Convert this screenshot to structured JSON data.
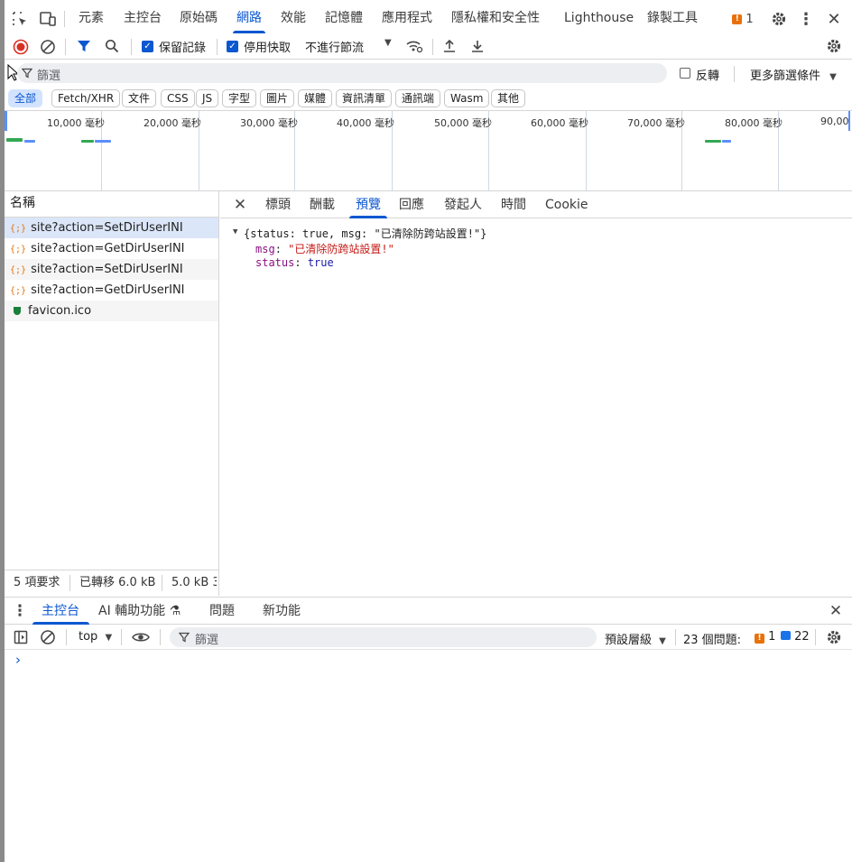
{
  "topbar": {
    "tabs": [
      {
        "label": "元素"
      },
      {
        "label": "主控台"
      },
      {
        "label": "原始碼"
      },
      {
        "label": "網路"
      },
      {
        "label": "效能"
      },
      {
        "label": "記憶體"
      },
      {
        "label": "應用程式"
      },
      {
        "label": "隱私權和安全性"
      },
      {
        "label": "Lighthouse"
      },
      {
        "label": "錄製工具"
      }
    ],
    "active_tab": "網路",
    "issue_count": "1",
    "icons": [
      "inspect-element-icon",
      "device-toolbar-icon",
      "issues-icon",
      "settings-icon",
      "more-vert-icon",
      "close-icon"
    ]
  },
  "toolbar": {
    "preserve_log_label": "保留記錄",
    "preserve_log_checked": true,
    "disable_cache_label": "停用快取",
    "disable_cache_checked": true,
    "throttling_value": "不進行節流"
  },
  "filter": {
    "placeholder": "篩選",
    "invert_label": "反轉",
    "more_filters_label": "更多篩選條件"
  },
  "type_filters": [
    "全部",
    "Fetch/XHR",
    "文件",
    "CSS",
    "JS",
    "字型",
    "圖片",
    "媒體",
    "資訊清單",
    "通訊端",
    "Wasm",
    "其他"
  ],
  "timeline": {
    "ticks": [
      "10,000 毫秒",
      "20,000 毫秒",
      "30,000 毫秒",
      "40,000 毫秒",
      "50,000 毫秒",
      "60,000 毫秒",
      "70,000 毫秒",
      "80,000 毫秒",
      "90,00"
    ]
  },
  "requests": {
    "header": "名稱",
    "items": [
      {
        "name": "site?action=SetDirUserINI",
        "type": "xhr"
      },
      {
        "name": "site?action=GetDirUserINI",
        "type": "xhr"
      },
      {
        "name": "site?action=SetDirUserINI",
        "type": "xhr"
      },
      {
        "name": "site?action=GetDirUserINI",
        "type": "xhr"
      },
      {
        "name": "favicon.ico",
        "type": "image"
      }
    ],
    "status": {
      "count": "5 項要求",
      "transferred": "已轉移 6.0 kB",
      "resources": "5.0 kB 3"
    }
  },
  "detail": {
    "tabs": [
      "標頭",
      "酬載",
      "預覽",
      "回應",
      "發起人",
      "時間",
      "Cookie"
    ],
    "active_tab": "預覽",
    "preview": {
      "summary": "{status: true, msg: \"已清除防跨站設置!\"}",
      "msg_key": "msg",
      "msg_value": "\"已清除防跨站設置!\"",
      "status_key": "status",
      "status_value": "true"
    }
  },
  "drawer": {
    "tabs": [
      "主控台",
      "AI 輔助功能 ⚗",
      "問題",
      "新功能"
    ],
    "active_tab": "主控台",
    "context": "top",
    "filter_placeholder": "篩選",
    "levels": "預設層級",
    "issues_label": "23 個問題:",
    "warning_count": "1",
    "info_count": "22",
    "prompt": "›"
  }
}
